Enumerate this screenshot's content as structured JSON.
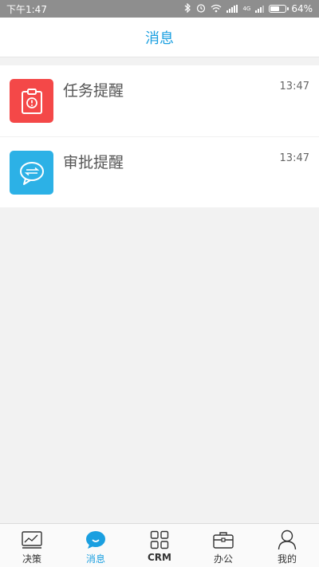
{
  "status_bar": {
    "time": "下午1:47",
    "network_label": "4G",
    "battery": "64%",
    "battery_level": 0.64
  },
  "header": {
    "title": "消息"
  },
  "messages": [
    {
      "title": "任务提醒",
      "time": "13:47",
      "icon": "task-clipboard-icon",
      "color": "#f44848"
    },
    {
      "title": "审批提醒",
      "time": "13:47",
      "icon": "approval-chat-icon",
      "color": "#2cb1e6"
    }
  ],
  "tabs": [
    {
      "label": "决策",
      "icon": "chart-line-icon",
      "active": false
    },
    {
      "label": "消息",
      "icon": "message-bubble-icon",
      "active": true
    },
    {
      "label": "CRM",
      "icon": "grid-squares-icon",
      "active": false
    },
    {
      "label": "办公",
      "icon": "briefcase-icon",
      "active": false
    },
    {
      "label": "我的",
      "icon": "person-icon",
      "active": false
    }
  ],
  "colors": {
    "accent": "#1a9fe0",
    "status_bar_bg": "#8e8e8e",
    "page_bg": "#f2f2f2"
  }
}
